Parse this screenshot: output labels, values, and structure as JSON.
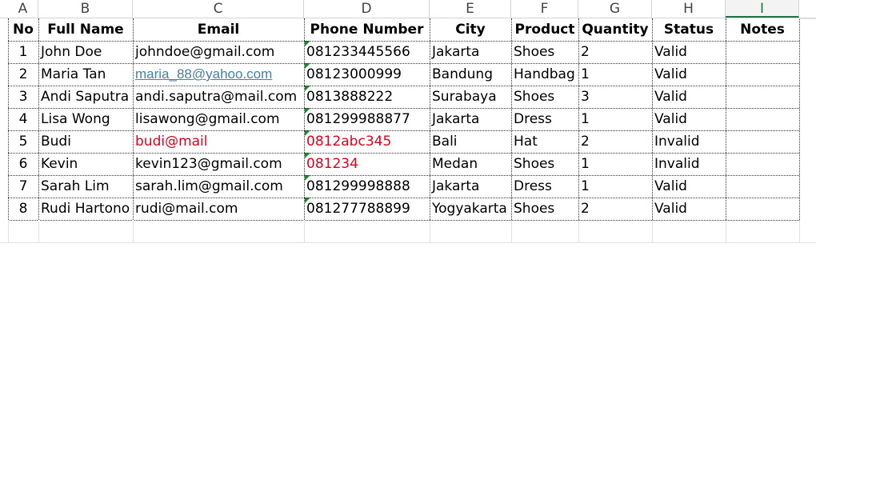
{
  "columns": [
    "A",
    "B",
    "C",
    "D",
    "E",
    "F",
    "G",
    "H",
    "I"
  ],
  "selected_column": "I",
  "row_stub_label": ")",
  "headers": [
    "No",
    "Full Name",
    "Email",
    "Phone Number",
    "City",
    "Product",
    "Quantity",
    "Status",
    "Notes"
  ],
  "rows": [
    {
      "no": "1",
      "name": "John Doe",
      "email": "johndoe@gmail.com",
      "phone": "081233445566",
      "city": "Jakarta",
      "product": "Shoes",
      "qty": "2",
      "status": "Valid",
      "notes": ""
    },
    {
      "no": "2",
      "name": "Maria Tan",
      "email": "maria_88@yahoo.com",
      "phone": "08123000999",
      "city": "Bandung",
      "product": "Handbag",
      "qty": "1",
      "status": "Valid",
      "notes": ""
    },
    {
      "no": "3",
      "name": "Andi Saputra",
      "email": "andi.saputra@mail.com",
      "phone": "0813888222",
      "city": "Surabaya",
      "product": "Shoes",
      "qty": "3",
      "status": "Valid",
      "notes": ""
    },
    {
      "no": "4",
      "name": "Lisa Wong",
      "email": "lisawong@gmail.com",
      "phone": "081299988877",
      "city": "Jakarta",
      "product": "Dress",
      "qty": "1",
      "status": "Valid",
      "notes": ""
    },
    {
      "no": "5",
      "name": "Budi",
      "email": "budi@mail",
      "phone": "0812abc345",
      "city": "Bali",
      "product": "Hat",
      "qty": "2",
      "status": "Invalid",
      "notes": ""
    },
    {
      "no": "6",
      "name": "Kevin",
      "email": "kevin123@gmail.com",
      "phone": "081234",
      "city": "Medan",
      "product": "Shoes",
      "qty": "1",
      "status": "Invalid",
      "notes": ""
    },
    {
      "no": "7",
      "name": "Sarah Lim",
      "email": "sarah.lim@gmail.com",
      "phone": "081299998888",
      "city": "Jakarta",
      "product": "Dress",
      "qty": "1",
      "status": "Valid",
      "notes": ""
    },
    {
      "no": "8",
      "name": "Rudi Hartono",
      "email": "rudi@mail.com",
      "phone": "081277788899",
      "city": "Yogyakarta",
      "product": "Shoes",
      "qty": "2",
      "status": "Valid",
      "notes": ""
    }
  ],
  "styles": {
    "invalid_text_color": "#e0001b",
    "link_color": "#4a7f9e",
    "selected_header_color": "#217346",
    "text_number_flag_color": "#1a8a2e"
  },
  "cell_flags": {
    "red_cells": [
      [
        "4",
        "email"
      ],
      [
        "4",
        "phone"
      ],
      [
        "5",
        "phone"
      ]
    ],
    "link_cells": [
      [
        "1",
        "email"
      ]
    ],
    "text_number_phone_rows": [
      0,
      1,
      2,
      3,
      4,
      5,
      6,
      7
    ]
  }
}
